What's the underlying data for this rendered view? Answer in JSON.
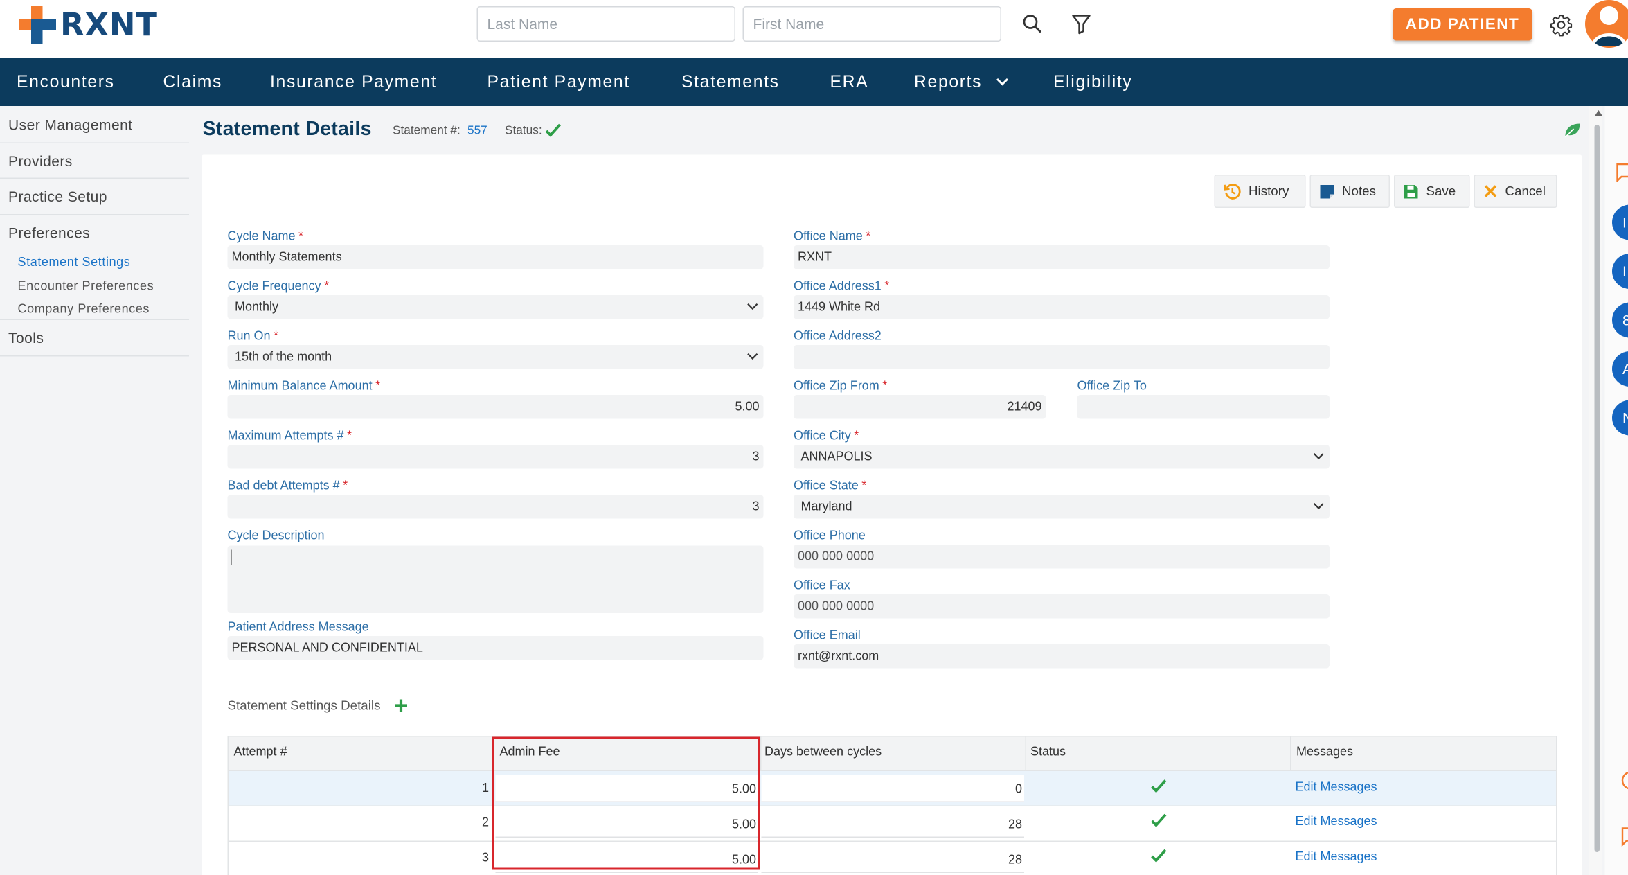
{
  "brand": {
    "name": "RXNT"
  },
  "search": {
    "last_name_placeholder": "Last Name",
    "first_name_placeholder": "First Name"
  },
  "header": {
    "add_patient_label": "ADD PATIENT"
  },
  "nav": {
    "encounters": "Encounters",
    "claims": "Claims",
    "insurance_payment": "Insurance Payment",
    "patient_payment": "Patient Payment",
    "statements": "Statements",
    "era": "ERA",
    "reports": "Reports",
    "eligibility": "Eligibility"
  },
  "sidebar": {
    "user_management": "User Management",
    "providers": "Providers",
    "practice_setup": "Practice Setup",
    "preferences": "Preferences",
    "statement_settings": "Statement Settings",
    "encounter_preferences": "Encounter Preferences",
    "company_preferences": "Company Preferences",
    "tools": "Tools"
  },
  "page": {
    "title": "Statement Details",
    "statement_label": "Statement #:",
    "statement_number": "557",
    "status_label": "Status:"
  },
  "actions": {
    "history": "History",
    "notes": "Notes",
    "save": "Save",
    "cancel": "Cancel"
  },
  "form": {
    "cycle_name": {
      "label": "Cycle Name",
      "value": "Monthly Statements"
    },
    "cycle_frequency": {
      "label": "Cycle Frequency",
      "value": "Monthly"
    },
    "run_on": {
      "label": "Run On",
      "value": "15th of the month"
    },
    "minimum_balance": {
      "label": "Minimum Balance Amount",
      "value": "5.00"
    },
    "maximum_attempts": {
      "label": "Maximum Attempts #",
      "value": "3"
    },
    "bad_debt_attempts": {
      "label": "Bad debt Attempts #",
      "value": "3"
    },
    "cycle_description": {
      "label": "Cycle Description",
      "value": ""
    },
    "patient_address_message": {
      "label": "Patient Address Message",
      "value": "PERSONAL AND CONFIDENTIAL"
    },
    "office_name": {
      "label": "Office Name",
      "value": "RXNT"
    },
    "office_address1": {
      "label": "Office Address1",
      "value": "1449 White Rd"
    },
    "office_address2": {
      "label": "Office Address2",
      "value": ""
    },
    "office_zip_from": {
      "label": "Office Zip From",
      "value": "21409"
    },
    "office_zip_to": {
      "label": "Office Zip To",
      "value": ""
    },
    "office_city": {
      "label": "Office City",
      "value": "ANNAPOLIS"
    },
    "office_state": {
      "label": "Office State",
      "value": "Maryland"
    },
    "office_phone": {
      "label": "Office Phone",
      "value": "000 000 0000"
    },
    "office_fax": {
      "label": "Office Fax",
      "value": "000 000 0000"
    },
    "office_email": {
      "label": "Office Email",
      "value": "rxnt@rxnt.com"
    },
    "required_mark": "*"
  },
  "details": {
    "title": "Statement Settings Details",
    "columns": {
      "attempt": "Attempt #",
      "admin_fee": "Admin Fee",
      "days_between": "Days between cycles",
      "status": "Status",
      "messages": "Messages"
    },
    "rows": [
      {
        "attempt": "1",
        "admin_fee": "5.00",
        "days": "0",
        "message_link": "Edit Messages"
      },
      {
        "attempt": "2",
        "admin_fee": "5.00",
        "days": "28",
        "message_link": "Edit Messages"
      },
      {
        "attempt": "3",
        "admin_fee": "5.00",
        "days": "28",
        "message_link": "Edit Messages"
      }
    ]
  },
  "rail": {
    "badges": [
      "I",
      "I",
      "8",
      "A",
      "N"
    ]
  },
  "colors": {
    "nav_bg": "#0c3b5d",
    "accent_orange": "#f47c2e",
    "link_blue": "#1a73c7",
    "success_green": "#2e9e48",
    "highlight_red": "#d8262c"
  }
}
